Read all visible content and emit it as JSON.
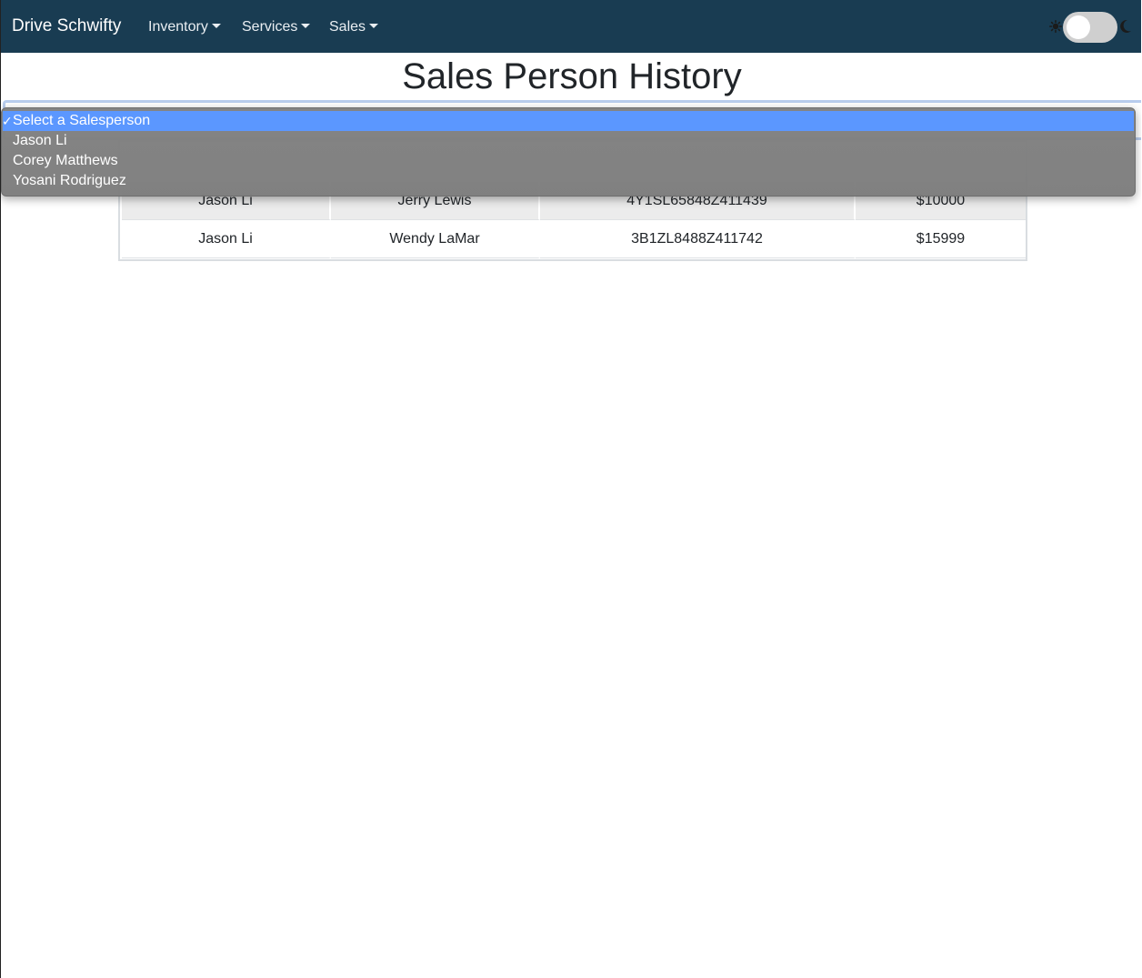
{
  "navbar": {
    "brand": "Drive Schwifty",
    "menus": [
      {
        "label": "Inventory"
      },
      {
        "label": "Services"
      },
      {
        "label": "Sales"
      }
    ],
    "background": "#193c52"
  },
  "page": {
    "title": "Sales Person History"
  },
  "salesperson_select": {
    "selected": "Select a Salesperson",
    "options": [
      {
        "label": "Select a Salesperson",
        "checked": true
      },
      {
        "label": "Jason Li"
      },
      {
        "label": "Corey Matthews"
      },
      {
        "label": "Yosani Rodriguez"
      }
    ],
    "highlight_color": "#5b97ff"
  },
  "sales_table": {
    "rows": [
      {
        "salesperson": "Jason Li",
        "customer": "Jerry Lewis",
        "vin": "4Y1SL65848Z411439",
        "price": "$10000"
      },
      {
        "salesperson": "Jason Li",
        "customer": "Wendy LaMar",
        "vin": "3B1ZL8488Z411742",
        "price": "$15999"
      }
    ]
  },
  "theme_toggle": {
    "state": "light",
    "icons": [
      "sun-icon",
      "moon-icon"
    ]
  }
}
